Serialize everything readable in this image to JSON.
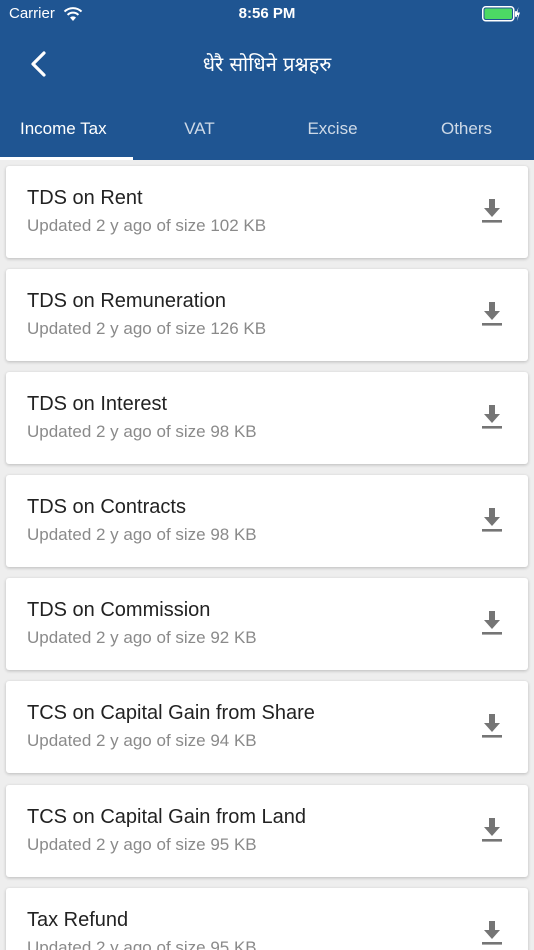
{
  "status_bar": {
    "carrier": "Carrier",
    "time": "8:56 PM"
  },
  "header": {
    "title": "धेरै सोधिने प्रश्नहरु"
  },
  "tabs": [
    {
      "label": "Income Tax",
      "active": true
    },
    {
      "label": "VAT",
      "active": false
    },
    {
      "label": "Excise",
      "active": false
    },
    {
      "label": "Others",
      "active": false
    }
  ],
  "items": [
    {
      "title": "TDS on Rent",
      "subtitle": "Updated 2 y ago of size 102 KB"
    },
    {
      "title": "TDS on Remuneration",
      "subtitle": "Updated 2 y ago of size 126 KB"
    },
    {
      "title": "TDS on Interest",
      "subtitle": "Updated 2 y ago of size 98 KB"
    },
    {
      "title": "TDS on Contracts",
      "subtitle": "Updated 2 y ago of size 98 KB"
    },
    {
      "title": "TDS on Commission",
      "subtitle": "Updated 2 y ago of size 92 KB"
    },
    {
      "title": "TCS on Capital Gain from Share",
      "subtitle": "Updated 2 y ago of size 94 KB"
    },
    {
      "title": "TCS on Capital Gain from Land",
      "subtitle": "Updated 2 y ago of size 95 KB"
    },
    {
      "title": "Tax Refund",
      "subtitle": "Updated 2 y ago of size 95 KB"
    }
  ],
  "colors": {
    "header": "#1f5592",
    "battery": "#4cd964"
  },
  "icons": {
    "back": "chevron-left-icon",
    "download": "download-icon",
    "wifi": "wifi-icon",
    "battery": "battery-icon"
  }
}
